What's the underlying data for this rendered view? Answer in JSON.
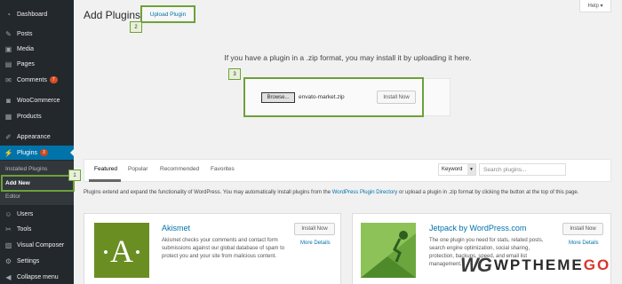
{
  "sidebar": {
    "items": [
      {
        "label": "Dashboard",
        "icon": "dashboard-icon",
        "glyph": "◔"
      },
      {
        "label": "Posts",
        "icon": "pin-icon",
        "glyph": "✎"
      },
      {
        "label": "Media",
        "icon": "media-icon",
        "glyph": "▣"
      },
      {
        "label": "Pages",
        "icon": "pages-icon",
        "glyph": "▤"
      },
      {
        "label": "Comments",
        "icon": "comment-icon",
        "glyph": "✉",
        "badge": "7"
      },
      {
        "label": "WooCommerce",
        "icon": "woocommerce-icon",
        "glyph": "◙"
      },
      {
        "label": "Products",
        "icon": "products-icon",
        "glyph": "▦"
      },
      {
        "label": "Appearance",
        "icon": "appearance-icon",
        "glyph": "✐"
      },
      {
        "label": "Plugins",
        "icon": "plugins-icon",
        "glyph": "⚡",
        "badge": "3"
      },
      {
        "label": "Users",
        "icon": "users-icon",
        "glyph": "☺"
      },
      {
        "label": "Tools",
        "icon": "tools-icon",
        "glyph": "✂"
      },
      {
        "label": "Visual Composer",
        "icon": "visual-composer-icon",
        "glyph": "▨"
      },
      {
        "label": "Settings",
        "icon": "settings-icon",
        "glyph": "⚙"
      },
      {
        "label": "Collapse menu",
        "icon": "collapse-icon",
        "glyph": "◀"
      }
    ],
    "submenu": {
      "installed": "Installed Plugins",
      "add_new": "Add New",
      "editor": "Editor"
    }
  },
  "header": {
    "title": "Add Plugins",
    "upload_button": "Upload Plugin",
    "help": "Help ▾"
  },
  "steps": {
    "one": "1",
    "two": "2",
    "three": "3"
  },
  "upload": {
    "instructions": "If you have a plugin in a .zip format, you may install it by uploading it here.",
    "browse": "Browse...",
    "filename": "envato-market.zip",
    "install": "Install Now"
  },
  "filters": {
    "tabs": [
      "Featured",
      "Popular",
      "Recommended",
      "Favorites"
    ],
    "keyword": "Keyword",
    "search_placeholder": "Search plugins..."
  },
  "description": {
    "before": "Plugins extend and expand the functionality of WordPress. You may automatically install plugins from the ",
    "link": "WordPress Plugin Directory",
    "after": " or upload a plugin in .zip format by clicking the button at the top of this page."
  },
  "plugins": [
    {
      "name": "Akismet",
      "text": "Akismet checks your comments and contact form submissions against our global database of spam to protect you and your site from malicious content.",
      "install": "Install Now",
      "more": "More Details",
      "thumb_color": "#6b8e23"
    },
    {
      "name": "Jetpack by WordPress.com",
      "text": "The one plugin you need for stats, related posts, search engine optimization, social sharing, protection, backups, speed, and email list management.",
      "install": "Install Now",
      "more": "More Details",
      "thumb_color": "#8cc258"
    }
  ],
  "watermark": {
    "logo": "WG",
    "name": "WPTHEME",
    "suffix": "GO"
  },
  "colors": {
    "accent": "#0073aa",
    "highlight": "#6da13b",
    "sidebar": "#23282d"
  }
}
